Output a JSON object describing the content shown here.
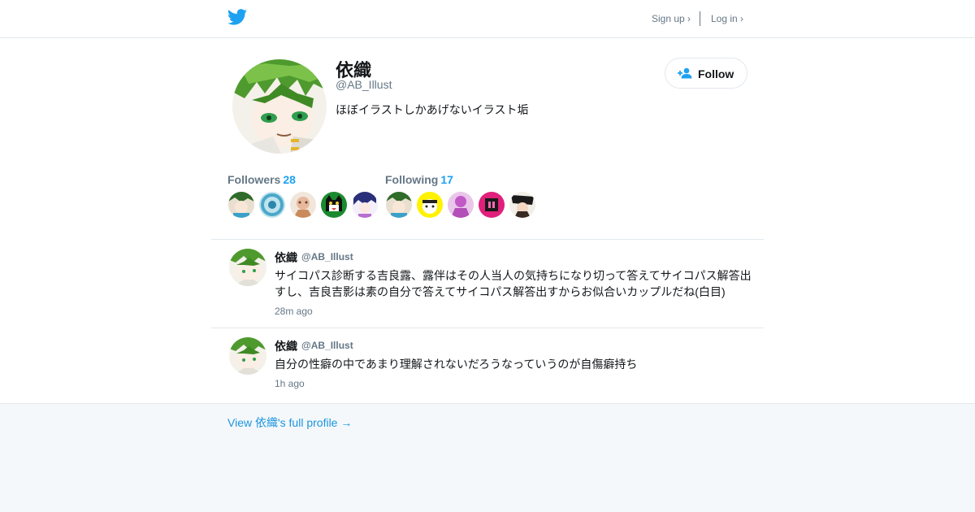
{
  "nav": {
    "signup_label": "Sign up ›",
    "login_label": "Log in ›"
  },
  "profile": {
    "name": "依織",
    "handle": "@AB_Illust",
    "bio": "ほぼイラストしかあげないイラスト垢",
    "follow_label": "Follow"
  },
  "stats": {
    "followers_label": "Followers",
    "followers_count": "28",
    "following_label": "Following",
    "following_count": "17"
  },
  "tweets": [
    {
      "name": "依織",
      "handle": "@AB_Illust",
      "text": "サイコパス診断する吉良露、露伴はその人当人の気持ちになり切って答えてサイコパス解答出すし、吉良吉影は素の自分で答えてサイコパス解答出すからお似合いカップルだね(白目)",
      "time": "28m ago"
    },
    {
      "name": "依織",
      "handle": "@AB_Illust",
      "text": "自分の性癖の中であまり理解されないだろうなっていうのが自傷癖持ち",
      "time": "1h ago"
    }
  ],
  "footer": {
    "full_profile_label": "View 依織's full profile →"
  },
  "colors": {
    "brand": "#1da1f2",
    "link": "#1b95e0",
    "muted": "#657786"
  },
  "icons": {
    "logo": "twitter-bird-icon",
    "follow": "add-user-icon"
  }
}
